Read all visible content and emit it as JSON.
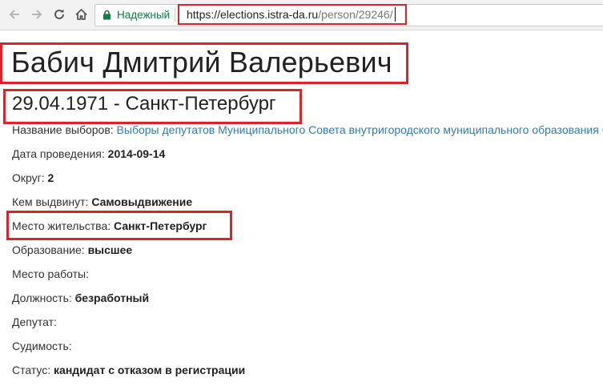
{
  "browser": {
    "secure_label": "Надежный",
    "url_host": "https://elections.istra-da.ru",
    "url_path": "/person/29246/"
  },
  "person": {
    "name": "Бабич Дмитрий Валерьевич",
    "dob_place": "29.04.1971 - Санкт-Петербург"
  },
  "fields": {
    "election": {
      "label": "Название выборов: ",
      "value": "Выборы депутатов Муниципального Совета внутригородского муниципального образования С"
    },
    "date": {
      "label": "Дата проведения: ",
      "value": "2014-09-14"
    },
    "district": {
      "label": "Округ: ",
      "value": "2"
    },
    "nominated": {
      "label": "Кем выдвинут: ",
      "value": "Самовыдвижение"
    },
    "residence": {
      "label": "Место жительства: ",
      "value": "Санкт-Петербург"
    },
    "education": {
      "label": "Образование: ",
      "value": "высшее"
    },
    "workplace": {
      "label": "Место работы:",
      "value": ""
    },
    "position": {
      "label": "Должность: ",
      "value": "безработный"
    },
    "deputy": {
      "label": "Депутат:",
      "value": ""
    },
    "conviction": {
      "label": "Судимость:",
      "value": ""
    },
    "status": {
      "label": "Статус: ",
      "value": "кандидат с отказом в регистрации"
    }
  },
  "colors": {
    "highlight": "#d9242a",
    "secure": "#0b8043",
    "link": "#337ab7"
  },
  "icons": [
    "back-arrow-icon",
    "forward-arrow-icon",
    "reload-icon",
    "home-icon",
    "lock-icon"
  ]
}
